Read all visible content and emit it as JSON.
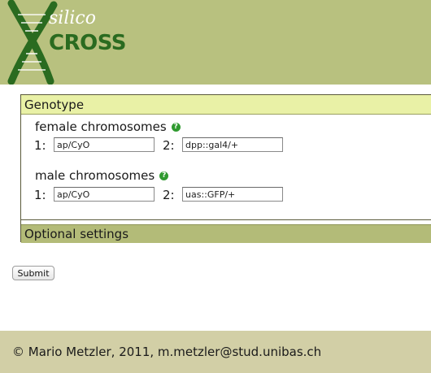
{
  "header": {
    "logo_text_top": "silico",
    "logo_text_bottom": "CROSS",
    "colors": {
      "background": "#b8c17f",
      "logo_green": "#2a6b20"
    }
  },
  "form": {
    "genotype_section": "Genotype",
    "female": {
      "title": "female chromosomes",
      "label_1": "1:",
      "value_1": "ap/CyO",
      "label_2": "2:",
      "value_2": "dpp::gal4/+"
    },
    "male": {
      "title": "male chromosomes",
      "label_1": "1:",
      "value_1": "ap/CyO",
      "label_2": "2:",
      "value_2": "uas::GFP/+"
    },
    "help_icon_glyph": "?",
    "optional_section": "Optional settings",
    "submit_label": "Submit"
  },
  "footer": {
    "text": "© Mario Metzler, 2011, m.metzler@stud.unibas.ch"
  }
}
